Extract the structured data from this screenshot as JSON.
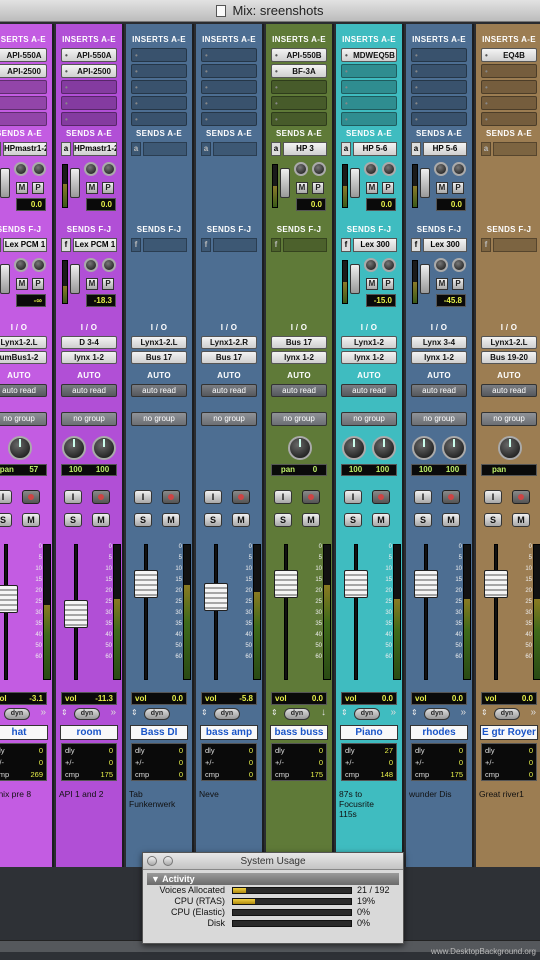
{
  "window": {
    "title": "Mix: sreenshots"
  },
  "labels": {
    "inserts": "INSERTS A-E",
    "sends_ae": "SENDS A-E",
    "sends_fj": "SENDS F-J",
    "io": "I / O",
    "auto": "AUTO",
    "send_a": "a",
    "send_f": "f",
    "btn_m": "M",
    "btn_p": "P",
    "btn_i": "I",
    "btn_s": "S",
    "vol": "vol",
    "dyn": "dyn",
    "dly": "dly",
    "plusminus": "+/-",
    "cmp": "cmp"
  },
  "strips": [
    {
      "id": "hat",
      "color": "#c35ce2",
      "inserts": [
        "API-550A",
        "API-2500",
        "",
        "",
        ""
      ],
      "send_ae": "HPmastr1-2",
      "send_ae_val": "0.0",
      "send_ae_meter": 0.5,
      "send_fj": "Lex PCM 1",
      "send_fj_val": "-∞",
      "send_fj_meter": 0.3,
      "io_in": "Lynx1-2.L",
      "io_out": "umBus1-2",
      "auto": "auto read",
      "group": "no group",
      "pan": [
        "pan",
        "57"
      ],
      "vol": "-3.1",
      "fader_pos": 0.38,
      "meter": 0.55,
      "name": "hat",
      "dly": "0",
      "pm": "0",
      "cmp": "269",
      "comment": "oenix pre 8",
      "arrow": "»"
    },
    {
      "id": "room",
      "color": "#b14fd6",
      "inserts": [
        "API-550A",
        "API-2500",
        "",
        "",
        ""
      ],
      "send_ae": "HPmastr1-2",
      "send_ae_val": "0.0",
      "send_ae_meter": 0.55,
      "send_fj": "Lex PCM 1",
      "send_fj_val": "-18.3",
      "send_fj_meter": 0.4,
      "io_in": "D 3-4",
      "io_out": "lynx 1-2",
      "auto": "auto read",
      "group": "no group",
      "pan": [
        "100",
        "100"
      ],
      "vol": "-11.3",
      "fader_pos": 0.52,
      "meter": 0.6,
      "name": "room",
      "dly": "0",
      "pm": "0",
      "cmp": "175",
      "comment": "API 1 and 2",
      "arrow": "»"
    },
    {
      "id": "bassdi",
      "color": "#4d6e92",
      "inserts": [
        "",
        "",
        "",
        "",
        ""
      ],
      "send_ae": "",
      "send_ae_val": "",
      "send_ae_meter": 0,
      "send_fj": "",
      "send_fj_val": "",
      "send_fj_meter": 0,
      "io_in": "Lynx1-2.L",
      "io_out": "Bus 17",
      "auto": "auto read",
      "group": "no group",
      "pan": [
        "",
        ""
      ],
      "vol": "0.0",
      "fader_pos": 0.24,
      "meter": 0.7,
      "name": "Bass DI",
      "dly": "0",
      "pm": "0",
      "cmp": "0",
      "comment": "Tab\nFunkenwerk",
      "arrow": ""
    },
    {
      "id": "bassamp",
      "color": "#4d6e92",
      "inserts": [
        "",
        "",
        "",
        "",
        ""
      ],
      "send_ae": "",
      "send_ae_val": "",
      "send_ae_meter": 0,
      "send_fj": "",
      "send_fj_val": "",
      "send_fj_meter": 0,
      "io_in": "Lynx1-2.R",
      "io_out": "Bus 17",
      "auto": "auto read",
      "group": "no group",
      "pan": [
        "",
        ""
      ],
      "vol": "-5.8",
      "fader_pos": 0.36,
      "meter": 0.65,
      "name": "bass amp",
      "dly": "0",
      "pm": "0",
      "cmp": "0",
      "comment": "Neve",
      "arrow": ""
    },
    {
      "id": "bassbuss",
      "color": "#5f7a38",
      "inserts": [
        "API-550B",
        "BF-3A",
        "",
        "",
        ""
      ],
      "send_ae": "HP 3",
      "send_ae_val": "0.0",
      "send_ae_meter": 0.5,
      "send_fj": "",
      "send_fj_val": "",
      "send_fj_meter": 0,
      "io_in": "Bus 17",
      "io_out": "lynx 1-2",
      "auto": "auto read",
      "group": "no group",
      "pan": [
        "pan",
        "0"
      ],
      "vol": "0.0",
      "fader_pos": 0.24,
      "meter": 0.7,
      "name": "bass buss",
      "dly": "0",
      "pm": "0",
      "cmp": "175",
      "comment": "",
      "arrow": "↓"
    },
    {
      "id": "piano",
      "color": "#3fbcc0",
      "inserts": [
        "MDWEQ5B",
        "",
        "",
        "",
        ""
      ],
      "send_ae": "HP 5-6",
      "send_ae_val": "0.0",
      "send_ae_meter": 0.5,
      "send_fj": "Lex 300",
      "send_fj_val": "-15.0",
      "send_fj_meter": 0.5,
      "io_in": "Lynx1-2",
      "io_out": "lynx 1-2",
      "auto": "auto read",
      "group": "no group",
      "pan": [
        "100",
        "100"
      ],
      "vol": "0.0",
      "fader_pos": 0.24,
      "meter": 0.6,
      "name": "Piano",
      "dly": "27",
      "pm": "0",
      "cmp": "148",
      "comment": "87s to\nFocusrite\n115s",
      "arrow": "»"
    },
    {
      "id": "rhodes",
      "color": "#4d6e92",
      "inserts": [
        "",
        "",
        "",
        "",
        ""
      ],
      "send_ae": "HP 5-6",
      "send_ae_val": "0.0",
      "send_ae_meter": 0.5,
      "send_fj": "Lex 300",
      "send_fj_val": "-45.8",
      "send_fj_meter": 0.5,
      "io_in": "Lynx 3-4",
      "io_out": "lynx 1-2",
      "auto": "auto read",
      "group": "no group",
      "pan": [
        "100",
        "100"
      ],
      "vol": "0.0",
      "fader_pos": 0.24,
      "meter": 0.6,
      "name": "rhodes",
      "dly": "0",
      "pm": "0",
      "cmp": "175",
      "comment": "wunder Dis",
      "arrow": "»"
    },
    {
      "id": "egtr",
      "color": "#9c7d52",
      "inserts": [
        "EQ4B",
        "",
        "",
        "",
        ""
      ],
      "send_ae": "",
      "send_ae_val": "",
      "send_ae_meter": 0,
      "send_fj": "",
      "send_fj_val": "",
      "send_fj_meter": 0,
      "io_in": "Lynx1-2.L",
      "io_out": "Bus 19-20",
      "auto": "auto read",
      "group": "no group",
      "pan": [
        "pan",
        ""
      ],
      "vol": "0.0",
      "fader_pos": 0.24,
      "meter": 0.6,
      "name": "E gtr Royer",
      "dly": "0",
      "pm": "0",
      "cmp": "0",
      "comment": "Great river1",
      "arrow": "»"
    }
  ],
  "system_usage": {
    "title": "System Usage",
    "section": "Activity",
    "rows": [
      {
        "label": "Voices Allocated",
        "value": "21 / 192",
        "fill": 0.11
      },
      {
        "label": "CPU (RTAS)",
        "value": "19%",
        "fill": 0.19
      },
      {
        "label": "CPU (Elastic)",
        "value": "0%",
        "fill": 0
      },
      {
        "label": "Disk",
        "value": "0%",
        "fill": 0
      }
    ]
  },
  "watermark": "www.DesktopBackground.org",
  "scale_ticks": [
    "0",
    "5",
    "10",
    "15",
    "20",
    "25",
    "30",
    "35",
    "40",
    "50",
    "60"
  ]
}
